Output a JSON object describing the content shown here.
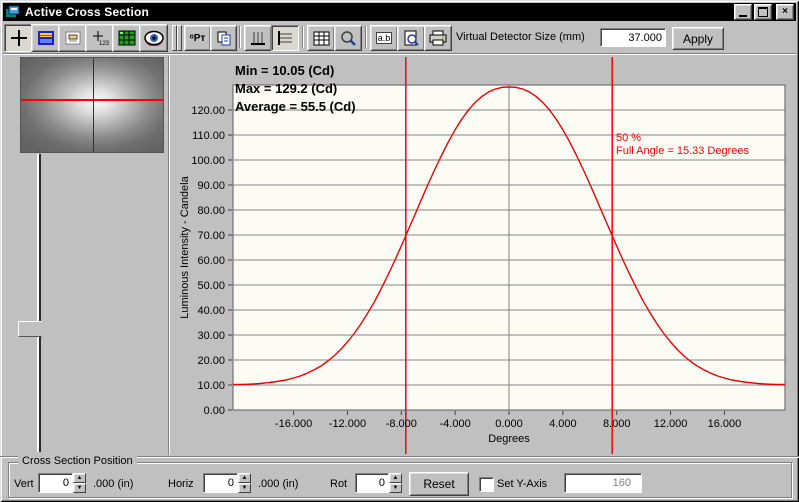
{
  "window": {
    "title": "Active Cross Section"
  },
  "colors": {
    "titlebar": "#000000",
    "curve": "#e60000",
    "marker": "#ff0000",
    "chrome": "#c0c0c0",
    "plot_bg": "#fcfcf4"
  },
  "icons": {
    "titlebar": [
      "app-icon",
      "minimize-icon",
      "maximize-icon",
      "close-icon"
    ],
    "left_toolbar": [
      "crosshair-icon",
      "beam-display-icon",
      "panel-icon",
      "position-readout-icon",
      "green-grid-icon",
      "eye-icon"
    ],
    "main_toolbar": [
      "pt-icon",
      "copy-icon",
      "vertical-profile-icon",
      "horizontal-profile-icon",
      "table-grid-icon",
      "zoom-icon",
      "label-ab-icon",
      "print-preview-icon",
      "printer-icon"
    ]
  },
  "toolbar": {
    "pt_label": "ᵒPᴛ",
    "ab_label": "a.b",
    "detector_label": "Virtual Detector Size (mm)",
    "detector_value": "37.000",
    "apply_label": "Apply"
  },
  "chart_data": {
    "type": "line",
    "title": "",
    "xlabel": "Degrees",
    "ylabel": "Luminous Intensity - Candela",
    "xlim": [
      -20.5,
      20.5
    ],
    "ylim": [
      0,
      130
    ],
    "grid": "horizontal gridlines every 10 plus vertical line at 0",
    "legend": "none",
    "x_ticks": [
      -16,
      -12,
      -8,
      -4,
      0,
      4,
      8,
      12,
      16
    ],
    "x_tick_labels": [
      "-16.000",
      "-12.000",
      "-8.000",
      "-4.000",
      "0.000",
      "4.000",
      "8.000",
      "12.000",
      "16.000"
    ],
    "y_ticks": [
      0,
      10,
      20,
      30,
      40,
      50,
      60,
      70,
      80,
      90,
      100,
      110,
      120
    ],
    "y_tick_labels": [
      "0.00",
      "10.00",
      "20.00",
      "30.00",
      "40.00",
      "50.00",
      "60.00",
      "70.00",
      "80.00",
      "90.00",
      "100.00",
      "110.00",
      "120.00"
    ],
    "stats_lines": [
      "Min = 10.05 (Cd)",
      "Max = 129.2 (Cd)",
      "Average = 55.5 (Cd)"
    ],
    "stats": {
      "min_cd": 10.05,
      "max_cd": 129.2,
      "average_cd": 55.5
    },
    "markers": {
      "color": "#ff0000",
      "x_values": [
        -7.665,
        7.665
      ]
    },
    "marker_label_lines": [
      "50 %",
      "Full Angle = 15.33 Degrees"
    ],
    "series": [
      {
        "name": "luminous-intensity-cross-section",
        "color": "#e60000",
        "x": [
          -20.5,
          -20,
          -19.5,
          -19,
          -18.5,
          -18,
          -17.5,
          -17,
          -16.5,
          -16,
          -15.5,
          -15,
          -14.5,
          -14,
          -13.5,
          -13,
          -12.5,
          -12,
          -11.5,
          -11,
          -10.5,
          -10,
          -9.5,
          -9,
          -8.5,
          -8,
          -7.5,
          -7,
          -6.5,
          -6,
          -5.5,
          -5,
          -4.5,
          -4,
          -3.5,
          -3,
          -2.5,
          -2,
          -1.5,
          -1,
          -0.5,
          0,
          0.5,
          1,
          1.5,
          2,
          2.5,
          3,
          3.5,
          4,
          4.5,
          5,
          5.5,
          6,
          6.5,
          7,
          7.5,
          8,
          8.5,
          9,
          9.5,
          10,
          10.5,
          11,
          11.5,
          12,
          12.5,
          13,
          13.5,
          14,
          14.5,
          15,
          15.5,
          16,
          16.5,
          17,
          17.5,
          18,
          18.5,
          19,
          19.5,
          20,
          20.5
        ],
        "y": [
          10.2,
          10.2,
          10.3,
          10.4,
          10.6,
          10.9,
          11.2,
          11.6,
          12.1,
          12.8,
          13.6,
          14.7,
          16.0,
          17.5,
          19.4,
          21.6,
          24.2,
          27.2,
          30.6,
          34.4,
          38.7,
          43.3,
          48.4,
          53.9,
          59.6,
          65.6,
          71.8,
          78.0,
          84.3,
          90.4,
          96.4,
          102.0,
          107.3,
          112.1,
          116.4,
          120.1,
          123.1,
          125.5,
          127.3,
          128.4,
          129.1,
          129.2,
          129.1,
          128.4,
          127.3,
          125.5,
          123.1,
          120.1,
          116.4,
          112.1,
          107.3,
          102.0,
          96.4,
          90.4,
          84.3,
          78.0,
          71.8,
          65.6,
          59.6,
          53.9,
          48.4,
          43.3,
          38.7,
          34.4,
          30.6,
          27.2,
          24.2,
          21.6,
          19.4,
          17.5,
          16.0,
          14.7,
          13.6,
          12.8,
          12.1,
          11.6,
          11.2,
          10.9,
          10.6,
          10.4,
          10.3,
          10.2,
          10.2
        ]
      }
    ]
  },
  "position_panel": {
    "group_label": "Cross Section Position",
    "vert_label": "Vert",
    "vert_value": "0",
    "vert_unit": ".000 (in)",
    "horiz_label": "Horiz",
    "horiz_value": "0",
    "horiz_unit": ".000 (in)",
    "rot_label": "Rot",
    "rot_value": "0",
    "reset_label": "Reset",
    "set_y_axis_label": "Set Y-Axis",
    "set_y_axis_checked": false,
    "y_axis_value": "160"
  }
}
